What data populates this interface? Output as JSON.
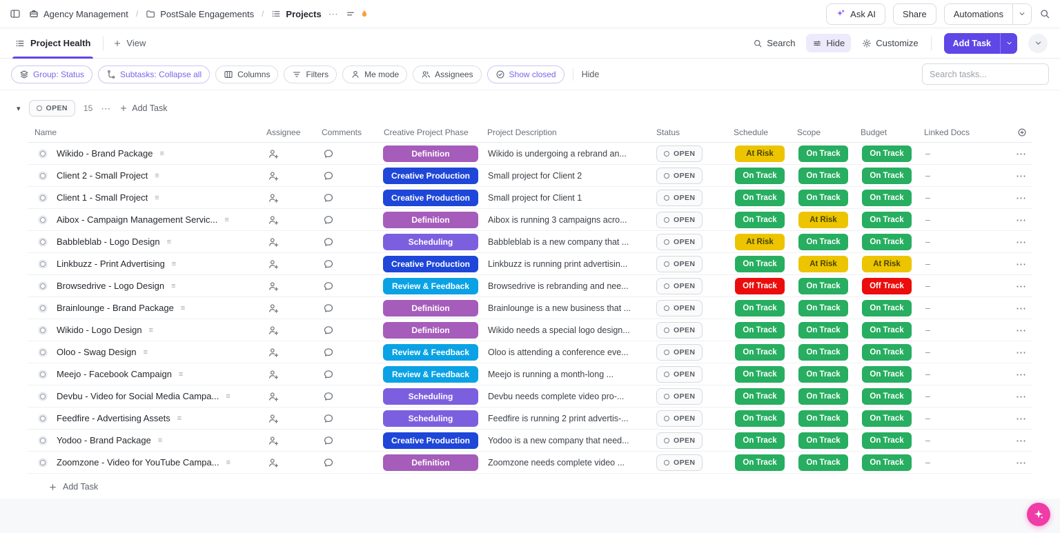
{
  "colors": {
    "accent": "#5e47e6",
    "fab": "#f03ca6",
    "phase": {
      "Definition": "#a55cba",
      "Creative Production": "#1e46d9",
      "Scheduling": "#7c5fdf",
      "Review & Feedback": "#0aa2e4"
    },
    "health": {
      "On Track": {
        "bg": "#27ae60",
        "fg": "#ffffff"
      },
      "At Risk": {
        "bg": "#ecc500",
        "fg": "#4a4300"
      },
      "Off Track": {
        "bg": "#eb0c0c",
        "fg": "#ffffff"
      }
    }
  },
  "topbar": {
    "breadcrumb": [
      {
        "icon": "workspace-icon",
        "label": "Agency Management"
      },
      {
        "icon": "folder-icon",
        "label": "PostSale Engagements"
      },
      {
        "icon": "list-icon",
        "label": "Projects"
      }
    ],
    "ask_ai_label": "Ask AI",
    "share_label": "Share",
    "automations_label": "Automations"
  },
  "viewbar": {
    "view_tab_label": "Project Health",
    "add_view_label": "View",
    "search_label": "Search",
    "hide_label": "Hide",
    "customize_label": "Customize",
    "add_task_label": "Add Task"
  },
  "toolbar": {
    "pills": [
      {
        "label": "Group: Status",
        "icon": "layers",
        "active": true
      },
      {
        "label": "Subtasks: Collapse all",
        "icon": "subtasks",
        "active": true
      },
      {
        "label": "Columns",
        "icon": "columns",
        "active": false
      },
      {
        "label": "Filters",
        "icon": "filters",
        "active": false
      },
      {
        "label": "Me mode",
        "icon": "user",
        "active": false
      },
      {
        "label": "Assignees",
        "icon": "users",
        "active": false
      },
      {
        "label": "Show closed",
        "icon": "check-circle",
        "active": true
      }
    ],
    "hide_label": "Hide",
    "search_placeholder": "Search tasks..."
  },
  "group": {
    "status_label": "OPEN",
    "count": "15",
    "add_task_label": "Add Task"
  },
  "table": {
    "columns": [
      "Name",
      "Assignee",
      "Comments",
      "Creative Project Phase",
      "Project Description",
      "Status",
      "Schedule",
      "Scope",
      "Budget",
      "Linked Docs"
    ],
    "rows": [
      {
        "name": "Wikido - Brand Package",
        "phase": "Definition",
        "description": "Wikido is undergoing a rebrand an...",
        "status": "OPEN",
        "schedule": "At Risk",
        "scope": "On Track",
        "budget": "On Track",
        "linked_docs": "–"
      },
      {
        "name": "Client 2 - Small Project",
        "phase": "Creative Production",
        "description": "Small project for Client 2",
        "status": "OPEN",
        "schedule": "On Track",
        "scope": "On Track",
        "budget": "On Track",
        "linked_docs": "–"
      },
      {
        "name": "Client 1 - Small Project",
        "phase": "Creative Production",
        "description": "Small project for Client 1",
        "status": "OPEN",
        "schedule": "On Track",
        "scope": "On Track",
        "budget": "On Track",
        "linked_docs": "–"
      },
      {
        "name": "Aibox - Campaign Management Servic...",
        "phase": "Definition",
        "description": "Aibox is running 3 campaigns acro...",
        "status": "OPEN",
        "schedule": "On Track",
        "scope": "At Risk",
        "budget": "On Track",
        "linked_docs": "–"
      },
      {
        "name": "Babbleblab - Logo Design",
        "phase": "Scheduling",
        "description": "Babbleblab is a new company that ...",
        "status": "OPEN",
        "schedule": "At Risk",
        "scope": "On Track",
        "budget": "On Track",
        "linked_docs": "–"
      },
      {
        "name": "Linkbuzz - Print Advertising",
        "phase": "Creative Production",
        "description": "Linkbuzz is running print advertisin...",
        "status": "OPEN",
        "schedule": "On Track",
        "scope": "At Risk",
        "budget": "At Risk",
        "linked_docs": "–"
      },
      {
        "name": "Browsedrive - Logo Design",
        "phase": "Review & Feedback",
        "description": "Browsedrive is rebranding and nee...",
        "status": "OPEN",
        "schedule": "Off Track",
        "scope": "On Track",
        "budget": "Off Track",
        "linked_docs": "–"
      },
      {
        "name": "Brainlounge - Brand Package",
        "phase": "Definition",
        "description": "Brainlounge is a new business that ...",
        "status": "OPEN",
        "schedule": "On Track",
        "scope": "On Track",
        "budget": "On Track",
        "linked_docs": "–"
      },
      {
        "name": "Wikido - Logo Design",
        "phase": "Definition",
        "description": "Wikido needs a special logo design...",
        "status": "OPEN",
        "schedule": "On Track",
        "scope": "On Track",
        "budget": "On Track",
        "linked_docs": "–"
      },
      {
        "name": "Oloo - Swag Design",
        "phase": "Review & Feedback",
        "description": "Oloo is attending a conference eve...",
        "status": "OPEN",
        "schedule": "On Track",
        "scope": "On Track",
        "budget": "On Track",
        "linked_docs": "–"
      },
      {
        "name": "Meejo - Facebook Campaign",
        "phase": "Review & Feedback",
        "description": "Meejo is running a month-long ...",
        "status": "OPEN",
        "schedule": "On Track",
        "scope": "On Track",
        "budget": "On Track",
        "linked_docs": "–"
      },
      {
        "name": "Devbu - Video for Social Media Campa...",
        "phase": "Scheduling",
        "description": "Devbu needs complete video pro-...",
        "status": "OPEN",
        "schedule": "On Track",
        "scope": "On Track",
        "budget": "On Track",
        "linked_docs": "–"
      },
      {
        "name": "Feedfire - Advertising Assets",
        "phase": "Scheduling",
        "description": "Feedfire is running 2 print advertis-...",
        "status": "OPEN",
        "schedule": "On Track",
        "scope": "On Track",
        "budget": "On Track",
        "linked_docs": "–"
      },
      {
        "name": "Yodoo - Brand Package",
        "phase": "Creative Production",
        "description": "Yodoo is a new company that need...",
        "status": "OPEN",
        "schedule": "On Track",
        "scope": "On Track",
        "budget": "On Track",
        "linked_docs": "–"
      },
      {
        "name": "Zoomzone - Video for YouTube Campa...",
        "phase": "Definition",
        "description": "Zoomzone needs complete video ...",
        "status": "OPEN",
        "schedule": "On Track",
        "scope": "On Track",
        "budget": "On Track",
        "linked_docs": "–"
      }
    ]
  },
  "footer": {
    "add_task_label": "Add Task"
  }
}
